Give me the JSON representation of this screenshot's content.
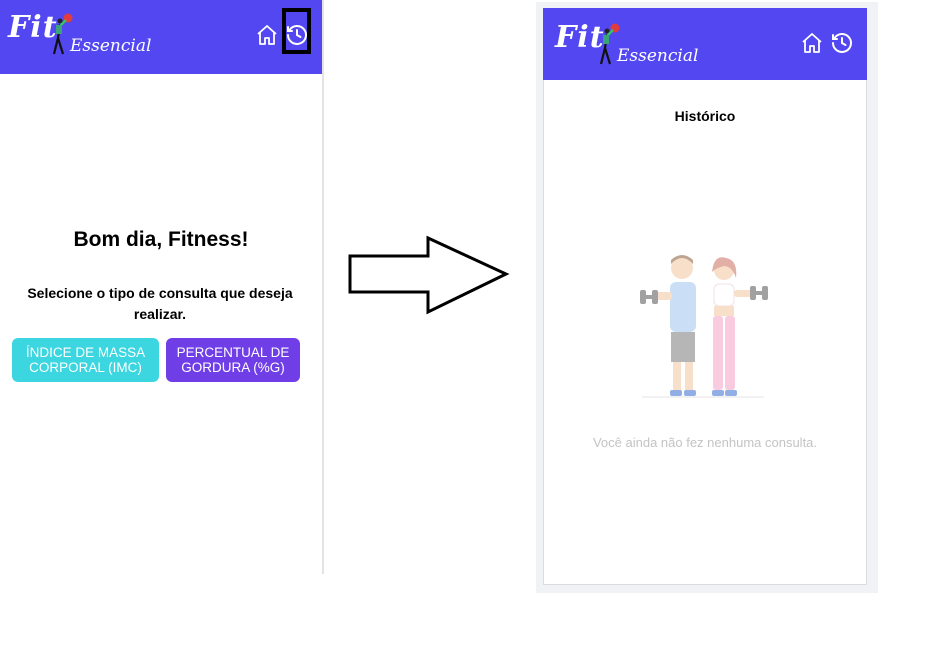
{
  "app": {
    "logo_text_main": "Fit",
    "logo_text_sub": "Essencial"
  },
  "colors": {
    "header": "#5247f1",
    "imc_button": "#3bd6df",
    "gordura_button": "#6f3ee6"
  },
  "left_screen": {
    "greeting": "Bom dia, Fitness!",
    "instruction": "Selecione o tipo de consulta que deseja realizar.",
    "buttons": {
      "imc": "ÍNDICE DE MASSA CORPORAL (IMC)",
      "gordura": "PERCENTUAL DE GORDURA (%G)"
    },
    "icons": {
      "home": "home-icon",
      "history": "history-icon"
    }
  },
  "right_screen": {
    "title": "Histórico",
    "empty_message": "Você ainda não fez nenhuma consulta."
  }
}
